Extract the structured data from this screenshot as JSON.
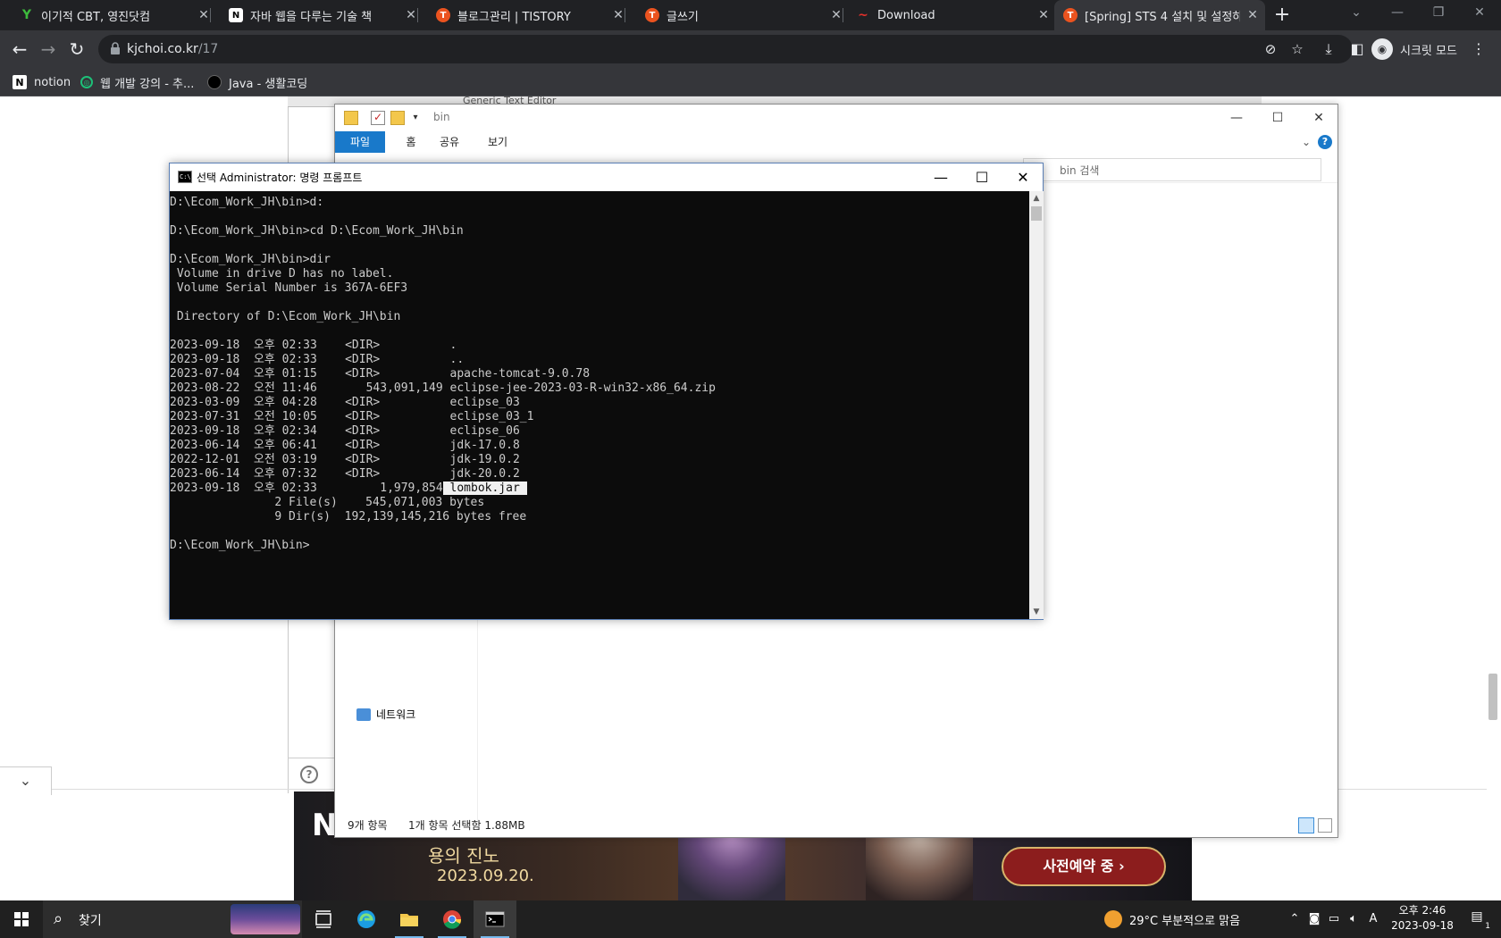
{
  "browser": {
    "tabs": [
      {
        "title": "이기적 CBT, 영진닷컴",
        "favicon": "Y",
        "color": "#3dbb3d"
      },
      {
        "title": "자바 웹을 다루는 기술 책",
        "favicon": "N",
        "color": "#ffffff"
      },
      {
        "title": "블로그관리 | TISTORY",
        "favicon": "T",
        "color": "#eb531f"
      },
      {
        "title": "글쓰기",
        "favicon": "T",
        "color": "#eb531f"
      },
      {
        "title": "Download",
        "favicon": "~",
        "color": "#e0302a"
      },
      {
        "title": "[Spring] STS 4 설치 및 설정하기",
        "favicon": "T",
        "color": "#eb531f"
      }
    ],
    "url_host": "kjchoi.co.kr",
    "url_path": "/17",
    "profile_label": "시크릿 모드",
    "bookmarks": [
      {
        "label": "notion",
        "icon": "notion-icon"
      },
      {
        "label": "웹 개발 강의 - 추...",
        "icon": "inflearn-icon"
      },
      {
        "label": "Java - 생활코딩",
        "icon": "opentutorials-icon"
      }
    ]
  },
  "page": {
    "inner_label": "Generic Text Editor",
    "ad": {
      "logo": "N",
      "subtitle": "용의 진노",
      "date": "2023.09.20.",
      "cta": "사전예약 중 ›"
    }
  },
  "explorer": {
    "title": "bin",
    "ribbon_tabs": [
      "파일",
      "홈",
      "공유",
      "보기"
    ],
    "search_placeholder": "bin 검색",
    "nav_network": "네트워크",
    "status_count": "9개 항목",
    "status_selection": "1개 항목 선택함 1.88MB"
  },
  "cmd": {
    "title": "선택 Administrator: 명령 프롬프트",
    "lines": [
      "D:\\Ecom_Work_JH\\bin>d:",
      "",
      "D:\\Ecom_Work_JH\\bin>cd D:\\Ecom_Work_JH\\bin",
      "",
      "D:\\Ecom_Work_JH\\bin>dir",
      " Volume in drive D has no label.",
      " Volume Serial Number is 367A-6EF3",
      "",
      " Directory of D:\\Ecom_Work_JH\\bin",
      "",
      "2023-09-18  오후 02:33    <DIR>          .",
      "2023-09-18  오후 02:33    <DIR>          ..",
      "2023-07-04  오후 01:15    <DIR>          apache-tomcat-9.0.78",
      "2023-08-22  오전 11:46       543,091,149 eclipse-jee-2023-03-R-win32-x86_64.zip",
      "2023-03-09  오후 04:28    <DIR>          eclipse_03",
      "2023-07-31  오전 10:05    <DIR>          eclipse_03_1",
      "2023-09-18  오후 02:34    <DIR>          eclipse_06",
      "2023-06-14  오후 06:41    <DIR>          jdk-17.0.8",
      "2022-12-01  오전 03:19    <DIR>          jdk-19.0.2",
      "2023-06-14  오후 07:32    <DIR>          jdk-20.0.2"
    ],
    "selected_line_prefix": "2023-09-18  오후 02:33         1,979,854",
    "selected_text": " lombok.jar ",
    "tail_lines": [
      "               2 File(s)    545,071,003 bytes",
      "               9 Dir(s)  192,139,145,216 bytes free",
      "",
      "D:\\Ecom_Work_JH\\bin>"
    ]
  },
  "taskbar": {
    "search_label": "찾기",
    "weather": "29°C  부분적으로 맑음",
    "time": "오후 2:46",
    "date": "2023-09-18",
    "ime": "A",
    "notification_count": "1"
  }
}
